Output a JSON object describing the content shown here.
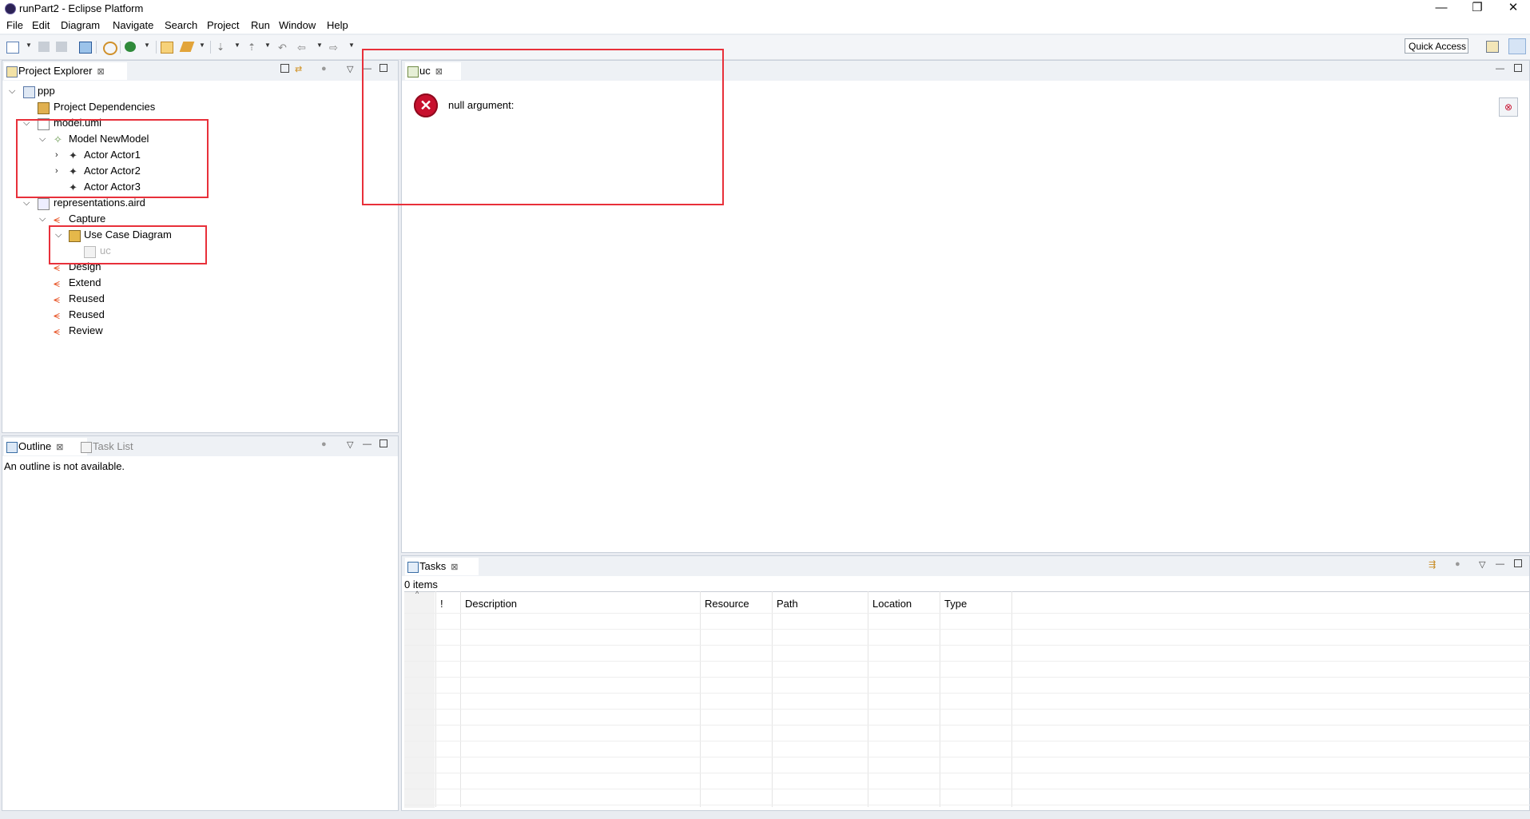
{
  "window": {
    "title": "runPart2 - Eclipse Platform",
    "controls": [
      "—",
      "❐",
      "✕"
    ]
  },
  "menubar": {
    "items": [
      "File",
      "Edit",
      "Diagram",
      "Navigate",
      "Search",
      "Project",
      "Run",
      "Window",
      "Help"
    ]
  },
  "toolbar": {
    "quick_access": "Quick Access"
  },
  "project_explorer": {
    "tab_label": "Project Explorer",
    "tree": [
      {
        "label": "ppp",
        "icon": "project-icon",
        "expanded": true
      },
      {
        "label": "Project Dependencies",
        "icon": "dependencies-icon"
      },
      {
        "label": "model.uml",
        "icon": "file-icon",
        "expanded": true
      },
      {
        "label": "Model NewModel",
        "icon": "model-icon",
        "expanded": true
      },
      {
        "label": "Actor Actor1",
        "icon": "actor-icon",
        "expanded": false
      },
      {
        "label": "Actor Actor2",
        "icon": "actor-icon",
        "expanded": false
      },
      {
        "label": "Actor Actor3",
        "icon": "actor-icon"
      },
      {
        "label": "representations.aird",
        "icon": "aird-file-icon",
        "expanded": true
      },
      {
        "label": "Capture",
        "icon": "viewpoint-icon",
        "expanded": true
      },
      {
        "label": "Use Case Diagram",
        "icon": "diagram-type-icon",
        "expanded": true
      },
      {
        "label": "uc",
        "icon": "diagram-icon"
      },
      {
        "label": "Design",
        "icon": "viewpoint-icon"
      },
      {
        "label": "Extend",
        "icon": "viewpoint-icon"
      },
      {
        "label": "Reused",
        "icon": "viewpoint-icon"
      },
      {
        "label": "Reused",
        "icon": "viewpoint-icon"
      },
      {
        "label": "Review",
        "icon": "viewpoint-icon"
      }
    ]
  },
  "outline": {
    "tab_label": "Outline",
    "second_tab_label": "Task List",
    "message": "An outline is not available."
  },
  "editor": {
    "tab_label": "uc",
    "error_message": "null argument:"
  },
  "tasks": {
    "tab_label": "Tasks",
    "count": "0 items",
    "columns": [
      "!",
      "Description",
      "Resource",
      "Path",
      "Location",
      "Type"
    ]
  },
  "colors": {
    "highlight_box": "#e8303a",
    "error_icon": "#c8102e",
    "viewpoint_icon": "#e8572a"
  }
}
